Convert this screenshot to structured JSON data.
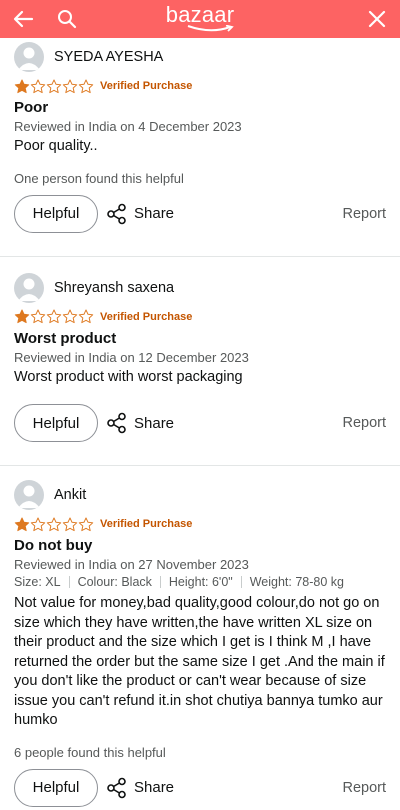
{
  "header": {
    "logo_text": "bazaar",
    "back_icon": "back-arrow-icon",
    "search_icon": "search-icon",
    "close_icon": "close-icon",
    "bg_color": "#fd6363"
  },
  "reviews": [
    {
      "user": "SYEDA AYESHA",
      "rating": 1,
      "verified": "Verified Purchase",
      "title": "Poor",
      "reviewed": "Reviewed in India on 4 December 2023",
      "body": "Poor quality..",
      "helpful_count": "One person found this helpful",
      "helpful_label": "Helpful",
      "share_label": "Share",
      "report_label": "Report"
    },
    {
      "user": "Shreyansh saxena",
      "rating": 1,
      "verified": "Verified Purchase",
      "title": "Worst product",
      "reviewed": "Reviewed in India on 12 December 2023",
      "body": "Worst product with worst packaging",
      "helpful_label": "Helpful",
      "share_label": "Share",
      "report_label": "Report"
    },
    {
      "user": "Ankit",
      "rating": 1,
      "verified": "Verified Purchase",
      "title": "Do not buy",
      "reviewed": "Reviewed in India on 27 November 2023",
      "meta": {
        "size": "Size: XL",
        "colour": "Colour: Black",
        "height": "Height: 6'0\"",
        "weight": "Weight: 78-80 kg"
      },
      "body": "Not value for money,bad quality,good colour,do not go on size which they have written,the have written XL size on their product and the size which I get is I think M ,I have returned the order but the same size I get .And the main if you don't like the product or can't wear because of size issue you can't refund it.in shot chutiya bannya tumko aur humko",
      "helpful_count": "6 people found this helpful",
      "helpful_label": "Helpful",
      "share_label": "Share",
      "report_label": "Report"
    }
  ],
  "colors": {
    "star_fill": "#de7921",
    "verified": "#c45500"
  }
}
